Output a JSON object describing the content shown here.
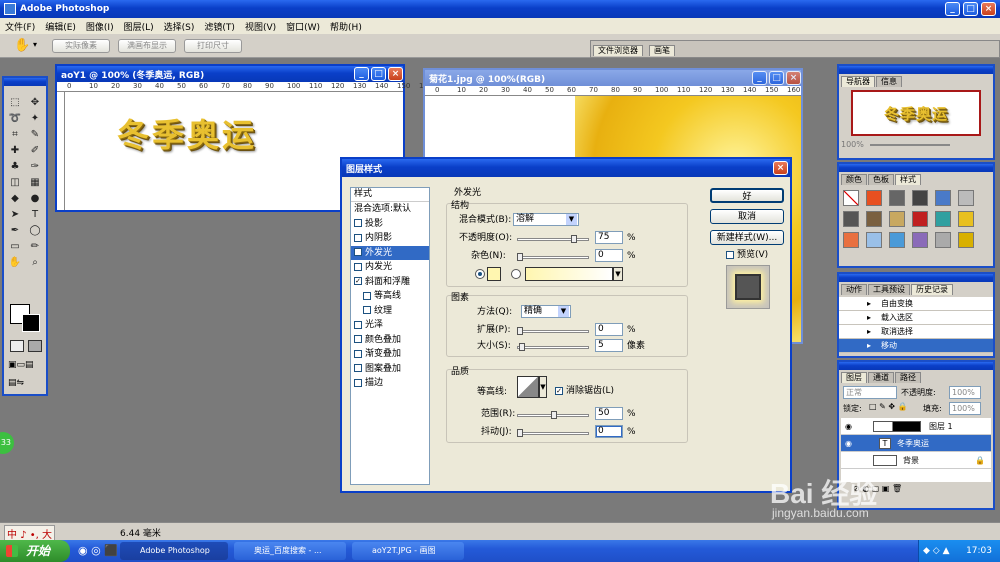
{
  "app": {
    "title": "Adobe Photoshop"
  },
  "menu": [
    "文件(F)",
    "编辑(E)",
    "图像(I)",
    "图层(L)",
    "选择(S)",
    "滤镜(T)",
    "视图(V)",
    "窗口(W)",
    "帮助(H)"
  ],
  "options": {
    "btn1": "实际像素",
    "btn2": "满画布显示",
    "btn3": "打印尺寸"
  },
  "palette_well": {
    "tab1": "文件浏览器",
    "tab2": "画笔"
  },
  "doc1": {
    "title": "aoY1 @ 100% (冬季奥运, RGB)",
    "zoom": "100%",
    "art": "冬季奥运"
  },
  "doc2": {
    "title": "菊花1.jpg @ 100%(RGB)"
  },
  "ruler_marks": [
    "0",
    "10",
    "20",
    "30",
    "40",
    "50",
    "60",
    "70",
    "80",
    "90",
    "100",
    "110",
    "120",
    "130",
    "140",
    "150",
    "160"
  ],
  "dialog": {
    "title": "图层样式",
    "styles_header": "样式",
    "styles": [
      {
        "label": "混合选项:默认",
        "checked": null
      },
      {
        "label": "投影",
        "checked": false
      },
      {
        "label": "内阴影",
        "checked": false
      },
      {
        "label": "外发光",
        "checked": true,
        "selected": true
      },
      {
        "label": "内发光",
        "checked": false
      },
      {
        "label": "斜面和浮雕",
        "checked": true
      },
      {
        "label": "等高线",
        "checked": false,
        "indent": true
      },
      {
        "label": "纹理",
        "checked": false,
        "indent": true
      },
      {
        "label": "光泽",
        "checked": false
      },
      {
        "label": "颜色叠加",
        "checked": false
      },
      {
        "label": "渐变叠加",
        "checked": false
      },
      {
        "label": "图案叠加",
        "checked": false
      },
      {
        "label": "描边",
        "checked": false
      }
    ],
    "section": "外发光",
    "structure": {
      "title": "结构",
      "blend_label": "混合模式(B):",
      "blend_value": "溶解",
      "opacity_label": "不透明度(O):",
      "opacity": "75",
      "noise_label": "杂色(N):",
      "noise": "0",
      "pct": "%"
    },
    "elements": {
      "title": "图素",
      "method_label": "方法(Q):",
      "method_value": "精确",
      "spread_label": "扩展(P):",
      "spread": "0",
      "size_label": "大小(S):",
      "size": "5",
      "px": "像素",
      "pct": "%"
    },
    "quality": {
      "title": "品质",
      "contour_label": "等高线:",
      "antialias_label": "消除锯齿(L)",
      "range_label": "范围(R):",
      "range": "50",
      "jitter_label": "抖动(J):",
      "jitter": "0",
      "pct": "%"
    },
    "ok": "好",
    "cancel": "取消",
    "new_style": "新建样式(W)...",
    "preview": "预览(V)"
  },
  "navigator": {
    "tab1": "导航器",
    "tab2": "信息",
    "art": "冬季奥运",
    "zoom": "100%"
  },
  "swatches_panel": {
    "tab1": "颜色",
    "tab2": "色板",
    "tab3": "样式"
  },
  "history": {
    "tab1": "动作",
    "tab2": "工具预设",
    "tab3": "历史记录",
    "items": [
      "自由变换",
      "载入选区",
      "取消选择",
      "移动"
    ]
  },
  "layers": {
    "tab1": "图层",
    "tab2": "通道",
    "tab3": "路径",
    "mode": "正常",
    "opacity_label": "不透明度:",
    "opacity": "100%",
    "lock_label": "锁定:",
    "fill_label": "填充:",
    "fill": "100%",
    "rows": [
      "图层 1",
      "冬季奥运",
      "背景"
    ]
  },
  "status": {
    "text": "6.44 毫米",
    "ime": "中 ♪ •, 大"
  },
  "taskbar": {
    "start": "开始",
    "items": [
      "Adobe Photoshop",
      "奥运_百度搜索 - ...",
      "aoY2T.JPG - 画图"
    ],
    "clock": "17:03"
  },
  "watermark": {
    "text": "Bai 经验",
    "url": "jingyan.baidu.com"
  },
  "side_badge": "33",
  "colors": {
    "xp_blue": "#0a3fc8",
    "panel": "#d4d0c8",
    "selection": "#316ac5",
    "gold": "#e8c030"
  }
}
